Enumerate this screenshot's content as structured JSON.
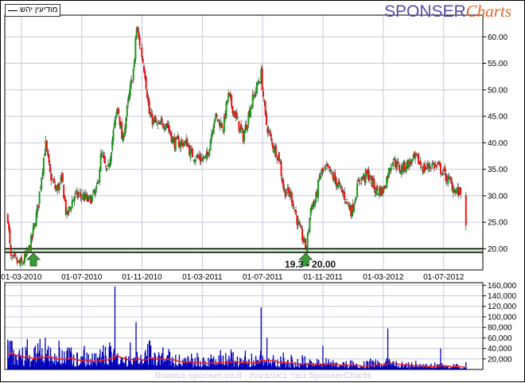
{
  "legend": {
    "label": "מודיעין יהש"
  },
  "logo": {
    "part1": "SPONSER",
    "part2": "Charts"
  },
  "watermark": "finance.sponser.co.il - נוצר באמצעות SponserCharts",
  "colors": {
    "up": "#1a9a1a",
    "down": "#ee1111",
    "volume": "#0000bb",
    "volume_ma": "#ee2222",
    "support_band": "#c8f0c0",
    "arrow": "#3a9a3a",
    "grid": "#c8c8dc"
  },
  "chart_data": [
    {
      "type": "candlestick",
      "title": "מודיעין יהש",
      "x_unit": "months since 01-01-2010",
      "xlim": [
        0.9,
        32.6
      ],
      "ylim": [
        16.0,
        64.1
      ],
      "x_ticks": [
        {
          "t": 2,
          "label": "01-03-2010"
        },
        {
          "t": 6,
          "label": "01-07-2010"
        },
        {
          "t": 10,
          "label": "01-11-2010"
        },
        {
          "t": 14,
          "label": "01-03-2011"
        },
        {
          "t": 18,
          "label": "01-07-2011"
        },
        {
          "t": 22,
          "label": "01-11-2011"
        },
        {
          "t": 26,
          "label": "01-03-2012"
        },
        {
          "t": 30,
          "label": "01-07-2012"
        }
      ],
      "y_ticks": [
        {
          "v": 20,
          "label": "20.00"
        },
        {
          "v": 25,
          "label": "25.00"
        },
        {
          "v": 30,
          "label": "30.00"
        },
        {
          "v": 35,
          "label": "35.00"
        },
        {
          "v": 40,
          "label": "40.00"
        },
        {
          "v": 45,
          "label": "45.00"
        },
        {
          "v": 50,
          "label": "50.00"
        },
        {
          "v": 55,
          "label": "55.00"
        },
        {
          "v": 60,
          "label": "60.00"
        }
      ],
      "close_path": [
        [
          1.1,
          26
        ],
        [
          1.3,
          18
        ],
        [
          2.0,
          17
        ],
        [
          2.4,
          19
        ],
        [
          2.7,
          22
        ],
        [
          3.1,
          28
        ],
        [
          3.3,
          33
        ],
        [
          3.6,
          40
        ],
        [
          3.9,
          34
        ],
        [
          4.3,
          31
        ],
        [
          4.7,
          33
        ],
        [
          5.0,
          26
        ],
        [
          5.5,
          30
        ],
        [
          6.0,
          30
        ],
        [
          6.5,
          29
        ],
        [
          7.0,
          31
        ],
        [
          7.3,
          38
        ],
        [
          7.7,
          34
        ],
        [
          8.1,
          42
        ],
        [
          8.4,
          47
        ],
        [
          8.7,
          40
        ],
        [
          9.1,
          48
        ],
        [
          9.5,
          55
        ],
        [
          9.6,
          62
        ],
        [
          9.9,
          58
        ],
        [
          10.2,
          53
        ],
        [
          10.5,
          45
        ],
        [
          11.1,
          43
        ],
        [
          11.6,
          44
        ],
        [
          12.1,
          40
        ],
        [
          13.0,
          40
        ],
        [
          13.2,
          38
        ],
        [
          13.8,
          37
        ],
        [
          14.3,
          37
        ],
        [
          14.8,
          45
        ],
        [
          15.4,
          43
        ],
        [
          15.7,
          49
        ],
        [
          16.2,
          45
        ],
        [
          16.7,
          41
        ],
        [
          17.2,
          47
        ],
        [
          17.9,
          53
        ],
        [
          18.2,
          44
        ],
        [
          18.6,
          40
        ],
        [
          19.1,
          37
        ],
        [
          19.4,
          31
        ],
        [
          19.9,
          30
        ],
        [
          20.4,
          24
        ],
        [
          20.9,
          20
        ],
        [
          21.2,
          28
        ],
        [
          21.5,
          29
        ],
        [
          21.8,
          34
        ],
        [
          22.3,
          35
        ],
        [
          22.8,
          33
        ],
        [
          23.4,
          30
        ],
        [
          23.9,
          27
        ],
        [
          24.4,
          33
        ],
        [
          25.0,
          34
        ],
        [
          25.5,
          31
        ],
        [
          26.0,
          31
        ],
        [
          26.6,
          37
        ],
        [
          27.1,
          35
        ],
        [
          27.6,
          36
        ],
        [
          28.2,
          37
        ],
        [
          28.7,
          35
        ],
        [
          29.2,
          36
        ],
        [
          29.8,
          35
        ],
        [
          30.3,
          33
        ],
        [
          30.8,
          31
        ],
        [
          31.4,
          30
        ],
        [
          31.5,
          24
        ]
      ],
      "support": {
        "low": 19.3,
        "high": 20.0,
        "label": "19.3 - 20.00"
      },
      "buy_signals_t": [
        2.8,
        20.85
      ]
    },
    {
      "type": "bar",
      "title": "Volume",
      "ylim": [
        0,
        165000
      ],
      "y_ticks": [
        {
          "v": 20000,
          "label": "20,000"
        },
        {
          "v": 40000,
          "label": "40,000"
        },
        {
          "v": 60000,
          "label": "60,000"
        },
        {
          "v": 80000,
          "label": "80,000"
        },
        {
          "v": 100000,
          "label": "100,000"
        },
        {
          "v": 120000,
          "label": "120,000"
        },
        {
          "v": 140000,
          "label": "140,000"
        },
        {
          "v": 160000,
          "label": "160,000"
        }
      ],
      "spikes": [
        [
          8.2,
          158000
        ],
        [
          9.6,
          90000
        ],
        [
          10.5,
          55000
        ],
        [
          17.9,
          118000
        ],
        [
          18.3,
          60000
        ],
        [
          22.0,
          45000
        ],
        [
          26.3,
          78000
        ],
        [
          29.8,
          40000
        ],
        [
          31.5,
          14000
        ]
      ],
      "baseline_start": 30000,
      "baseline_end": 5000
    }
  ]
}
